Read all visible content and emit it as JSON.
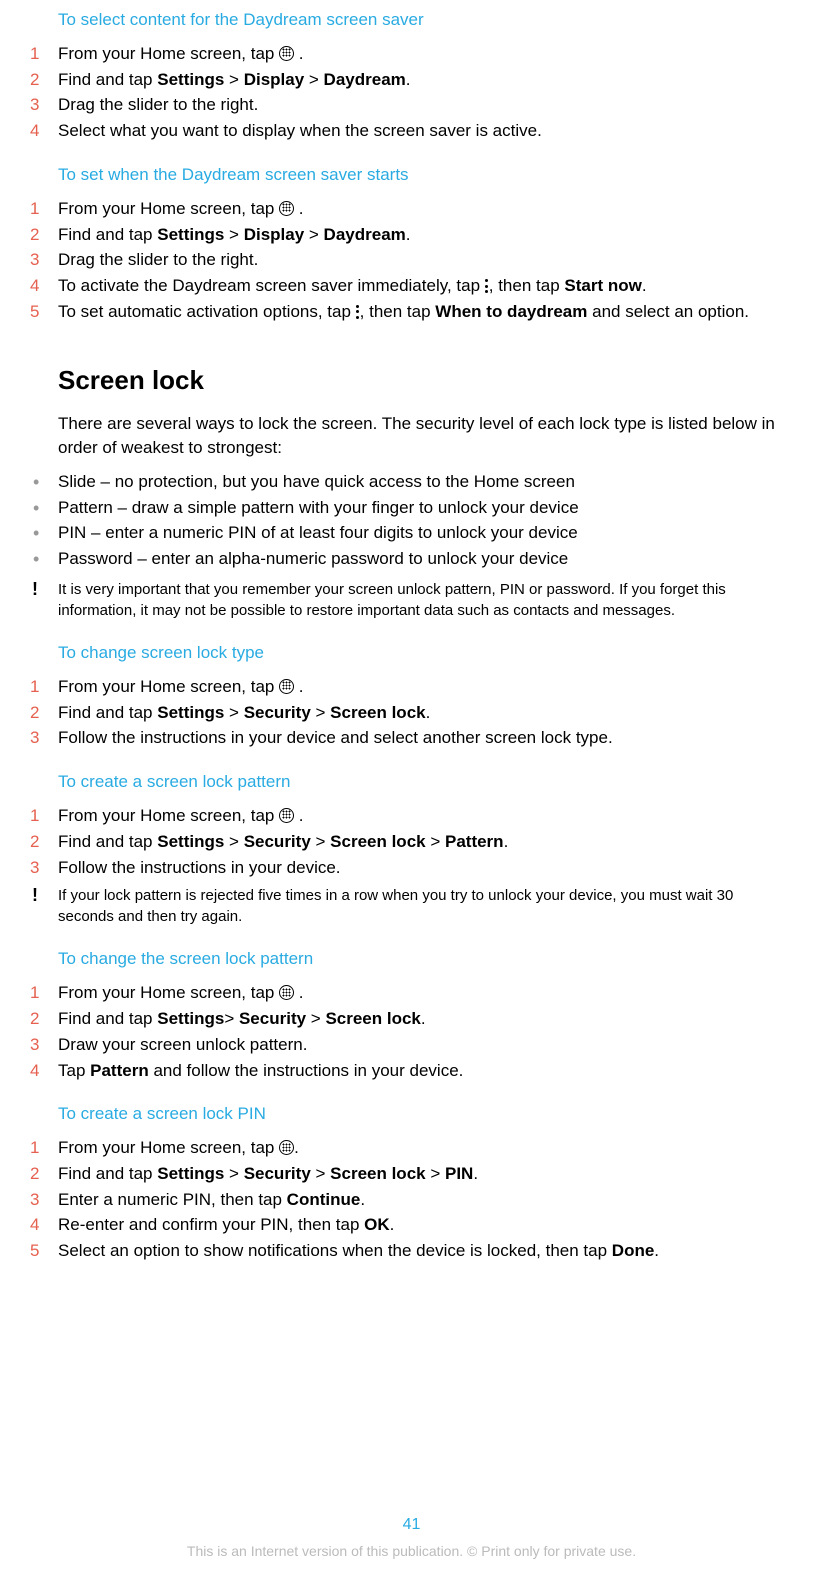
{
  "sections": {
    "daydream_content": {
      "heading": "To select content for the Daydream screen saver",
      "steps": [
        {
          "pre": "From your Home screen, tap ",
          "icon": "apps",
          "post": " ."
        },
        {
          "segments": [
            "Find and tap ",
            {
              "b": "Settings"
            },
            " > ",
            {
              "b": "Display"
            },
            " > ",
            {
              "b": "Daydream"
            },
            "."
          ]
        },
        {
          "text": "Drag the slider to the right."
        },
        {
          "text": "Select what you want to display when the screen saver is active."
        }
      ]
    },
    "daydream_starts": {
      "heading": "To set when the Daydream screen saver starts",
      "steps": [
        {
          "pre": "From your Home screen, tap ",
          "icon": "apps",
          "post": " ."
        },
        {
          "segments": [
            "Find and tap ",
            {
              "b": "Settings"
            },
            " > ",
            {
              "b": "Display"
            },
            " > ",
            {
              "b": "Daydream"
            },
            "."
          ]
        },
        {
          "text": "Drag the slider to the right."
        },
        {
          "segments": [
            "To activate the Daydream screen saver immediately, tap ",
            {
              "icon": "more"
            },
            ", then tap ",
            {
              "b": "Start now"
            },
            "."
          ]
        },
        {
          "segments": [
            "To set automatic activation options, tap ",
            {
              "icon": "more"
            },
            ", then tap ",
            {
              "b": "When to daydream"
            },
            " and select an option."
          ]
        }
      ]
    },
    "screen_lock": {
      "title": "Screen lock",
      "intro": "There are several ways to lock the screen. The security level of each lock type is listed below in order of weakest to strongest:",
      "bullets": [
        "Slide – no protection, but you have quick access to the Home screen",
        "Pattern – draw a simple pattern with your finger to unlock your device",
        "PIN – enter a numeric PIN of at least four digits to unlock your device",
        "Password – enter an alpha-numeric password to unlock your device"
      ],
      "warning": "It is very important that you remember your screen unlock pattern, PIN or password. If you forget this information, it may not be possible to restore important data such as contacts and messages."
    },
    "change_lock_type": {
      "heading": "To change screen lock type",
      "steps": [
        {
          "pre": "From your Home screen, tap ",
          "icon": "apps",
          "post": " ."
        },
        {
          "segments": [
            "Find and tap ",
            {
              "b": "Settings"
            },
            " > ",
            {
              "b": "Security"
            },
            " > ",
            {
              "b": "Screen lock"
            },
            "."
          ]
        },
        {
          "text": "Follow the instructions in your device and select another screen lock type."
        }
      ]
    },
    "create_pattern": {
      "heading": "To create a screen lock pattern",
      "steps": [
        {
          "pre": "From your Home screen, tap ",
          "icon": "apps",
          "post": " ."
        },
        {
          "segments": [
            "Find and tap ",
            {
              "b": "Settings"
            },
            " > ",
            {
              "b": "Security"
            },
            " > ",
            {
              "b": "Screen lock"
            },
            " > ",
            {
              "b": "Pattern"
            },
            "."
          ]
        },
        {
          "text": "Follow the instructions in your device."
        }
      ],
      "warning": "If your lock pattern is rejected five times in a row when you try to unlock your device, you must wait 30 seconds and then try again."
    },
    "change_pattern": {
      "heading": "To change the screen lock pattern",
      "steps": [
        {
          "pre": "From your Home screen, tap ",
          "icon": "apps",
          "post": " ."
        },
        {
          "segments": [
            "Find and tap ",
            {
              "b": "Settings"
            },
            "> ",
            {
              "b": "Security"
            },
            " > ",
            {
              "b": "Screen lock"
            },
            "."
          ]
        },
        {
          "text": "Draw your screen unlock pattern."
        },
        {
          "segments": [
            "Tap ",
            {
              "b": "Pattern"
            },
            " and follow the instructions in your device."
          ]
        }
      ]
    },
    "create_pin": {
      "heading": "To create a screen lock PIN",
      "steps": [
        {
          "pre": "From your Home screen, tap ",
          "icon": "apps",
          "post": "."
        },
        {
          "segments": [
            "Find and tap ",
            {
              "b": "Settings"
            },
            " > ",
            {
              "b": "Security"
            },
            " > ",
            {
              "b": "Screen lock"
            },
            " > ",
            {
              "b": "PIN"
            },
            "."
          ]
        },
        {
          "segments": [
            "Enter a numeric PIN, then tap ",
            {
              "b": "Continue"
            },
            "."
          ]
        },
        {
          "segments": [
            "Re-enter and confirm your PIN, then tap ",
            {
              "b": "OK"
            },
            "."
          ]
        },
        {
          "segments": [
            "Select an option to show notifications when the device is locked, then tap ",
            {
              "b": "Done"
            },
            "."
          ]
        }
      ]
    }
  },
  "page_number": "41",
  "footer": "This is an Internet version of this publication. © Print only for private use."
}
